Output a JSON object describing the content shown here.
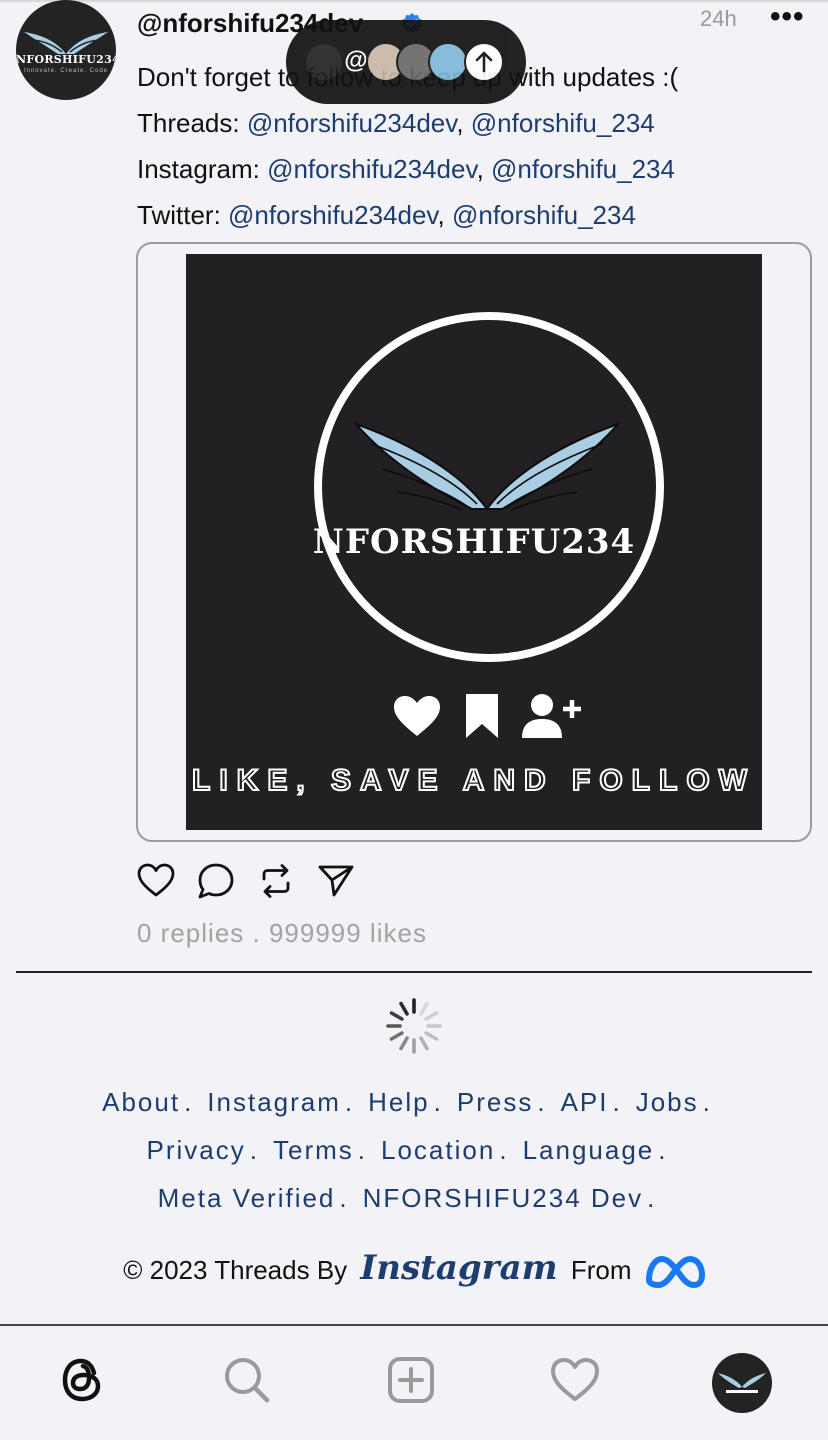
{
  "post": {
    "username": "@nforshifu234dev",
    "timestamp": "24h",
    "more_label": "•••",
    "text_line1": "Don't forget to follow to keep up with updates :(",
    "threads_label": "Threads: ",
    "instagram_label": "Instagram: ",
    "twitter_label": "Twitter: ",
    "handle_primary": "@nforshifu234dev",
    "handle_secondary": "@nforshifu_234",
    "separator": ", ",
    "avatar_text": "NFORSHIFU234",
    "avatar_subtext": "Innovate. Create. Code"
  },
  "media": {
    "brand_text": "NFORSHIFU234",
    "cta_text": "LIKE, SAVE AND FOLLOW"
  },
  "stats": {
    "replies": "0 replies",
    "dot": " . ",
    "likes": "999999 likes"
  },
  "footer": {
    "row1": [
      "About",
      "Instagram",
      "Help",
      "Press",
      "API",
      "Jobs"
    ],
    "row2": [
      "Privacy",
      "Terms",
      "Location",
      "Language"
    ],
    "row3": [
      "Meta Verified",
      "NFORSHIFU234 Dev"
    ],
    "dot": ".",
    "copyright_prefix": "© 2023 Threads By",
    "instagram_wordmark": "Instagram",
    "from_label": "From"
  },
  "bubble": {
    "threads_glyph": "@"
  },
  "colors": {
    "link": "#1d3d6e",
    "background": "#f2f2f7",
    "verified": "#2d7ff9",
    "meta": "#1877f2"
  },
  "nav": {
    "items": [
      "threads-home-icon",
      "search-icon",
      "new-post-icon",
      "activity-heart-icon",
      "profile-avatar"
    ]
  }
}
